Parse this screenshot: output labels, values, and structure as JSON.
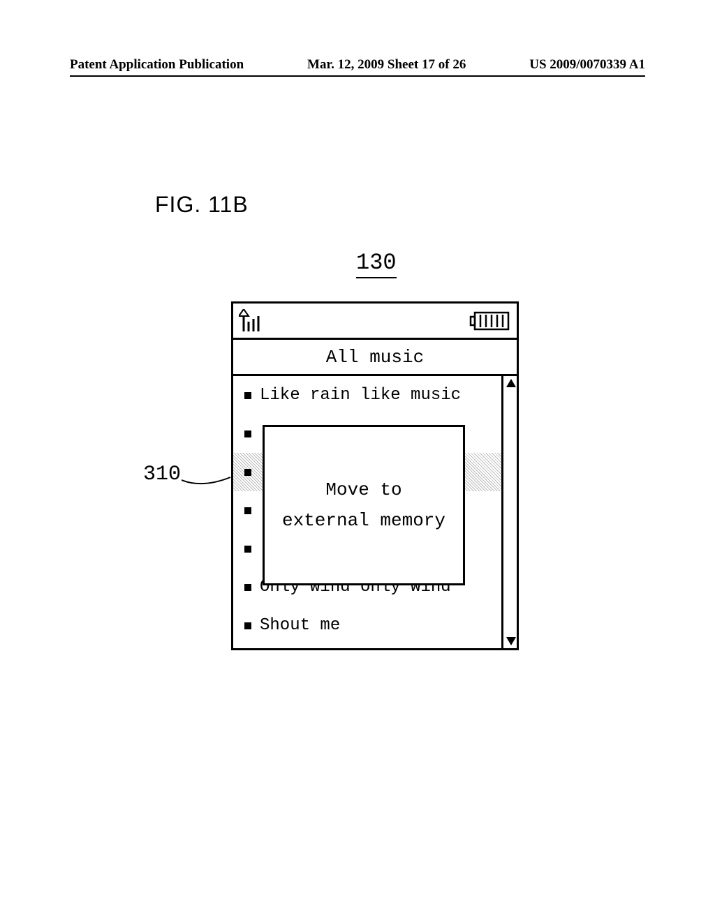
{
  "header": {
    "left": "Patent Application Publication",
    "center": "Mar. 12, 2009  Sheet 17 of 26",
    "right": "US 2009/0070339 A1"
  },
  "figure_label": "FIG. 11B",
  "ref_top": "130",
  "ref_side": "310",
  "screen": {
    "title": "All music",
    "rows": [
      "Like rain like music",
      "",
      "",
      "",
      "",
      "Only wind only wind",
      "Shout me"
    ],
    "highlighted_index": 2,
    "popup": {
      "line1": "Move to",
      "line2": "external memory"
    }
  }
}
